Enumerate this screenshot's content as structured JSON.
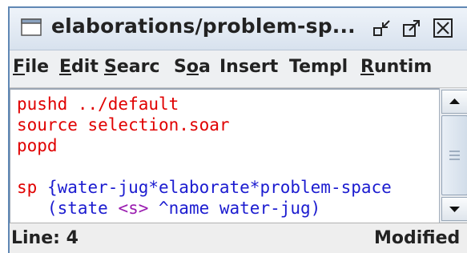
{
  "window": {
    "title": "elaborations/problem-sp...",
    "controls": {
      "minimize_icon": "minimize-icon",
      "maximize_icon": "maximize-icon",
      "close_icon": "close-icon"
    }
  },
  "menubar": {
    "items": [
      {
        "label": "File",
        "mnemonic_index": 0
      },
      {
        "label": "Edit",
        "mnemonic_index": 0
      },
      {
        "label": "Searc",
        "mnemonic_index": 0
      },
      {
        "label": "Soa",
        "mnemonic_index": 1
      },
      {
        "label": "Insert",
        "mnemonic_index": -1
      },
      {
        "label": "Templ",
        "mnemonic_index": -1
      },
      {
        "label": "Runtim",
        "mnemonic_index": 0
      }
    ]
  },
  "editor": {
    "lines": [
      {
        "segments": [
          {
            "text": "pushd ../default",
            "color": "red"
          }
        ]
      },
      {
        "segments": [
          {
            "text": "source selection.soar",
            "color": "red"
          }
        ]
      },
      {
        "segments": [
          {
            "text": "popd",
            "color": "red"
          }
        ]
      },
      {
        "segments": [
          {
            "text": "",
            "color": "dark"
          }
        ]
      },
      {
        "segments": [
          {
            "text": "sp ",
            "color": "red"
          },
          {
            "text": "{water-jug*elaborate*problem-space",
            "color": "blue"
          }
        ]
      },
      {
        "segments": [
          {
            "text": "   (state ",
            "color": "blue"
          },
          {
            "text": "<s>",
            "color": "purple"
          },
          {
            "text": " ^name water-jug)",
            "color": "blue"
          }
        ]
      }
    ]
  },
  "status": {
    "line": "Line: 4",
    "state": "Modified"
  },
  "colors": {
    "keyword": "#e00000",
    "production": "#1c1cd0",
    "variable": "#9a1cb0",
    "title_bar": "#d8e2ee"
  }
}
